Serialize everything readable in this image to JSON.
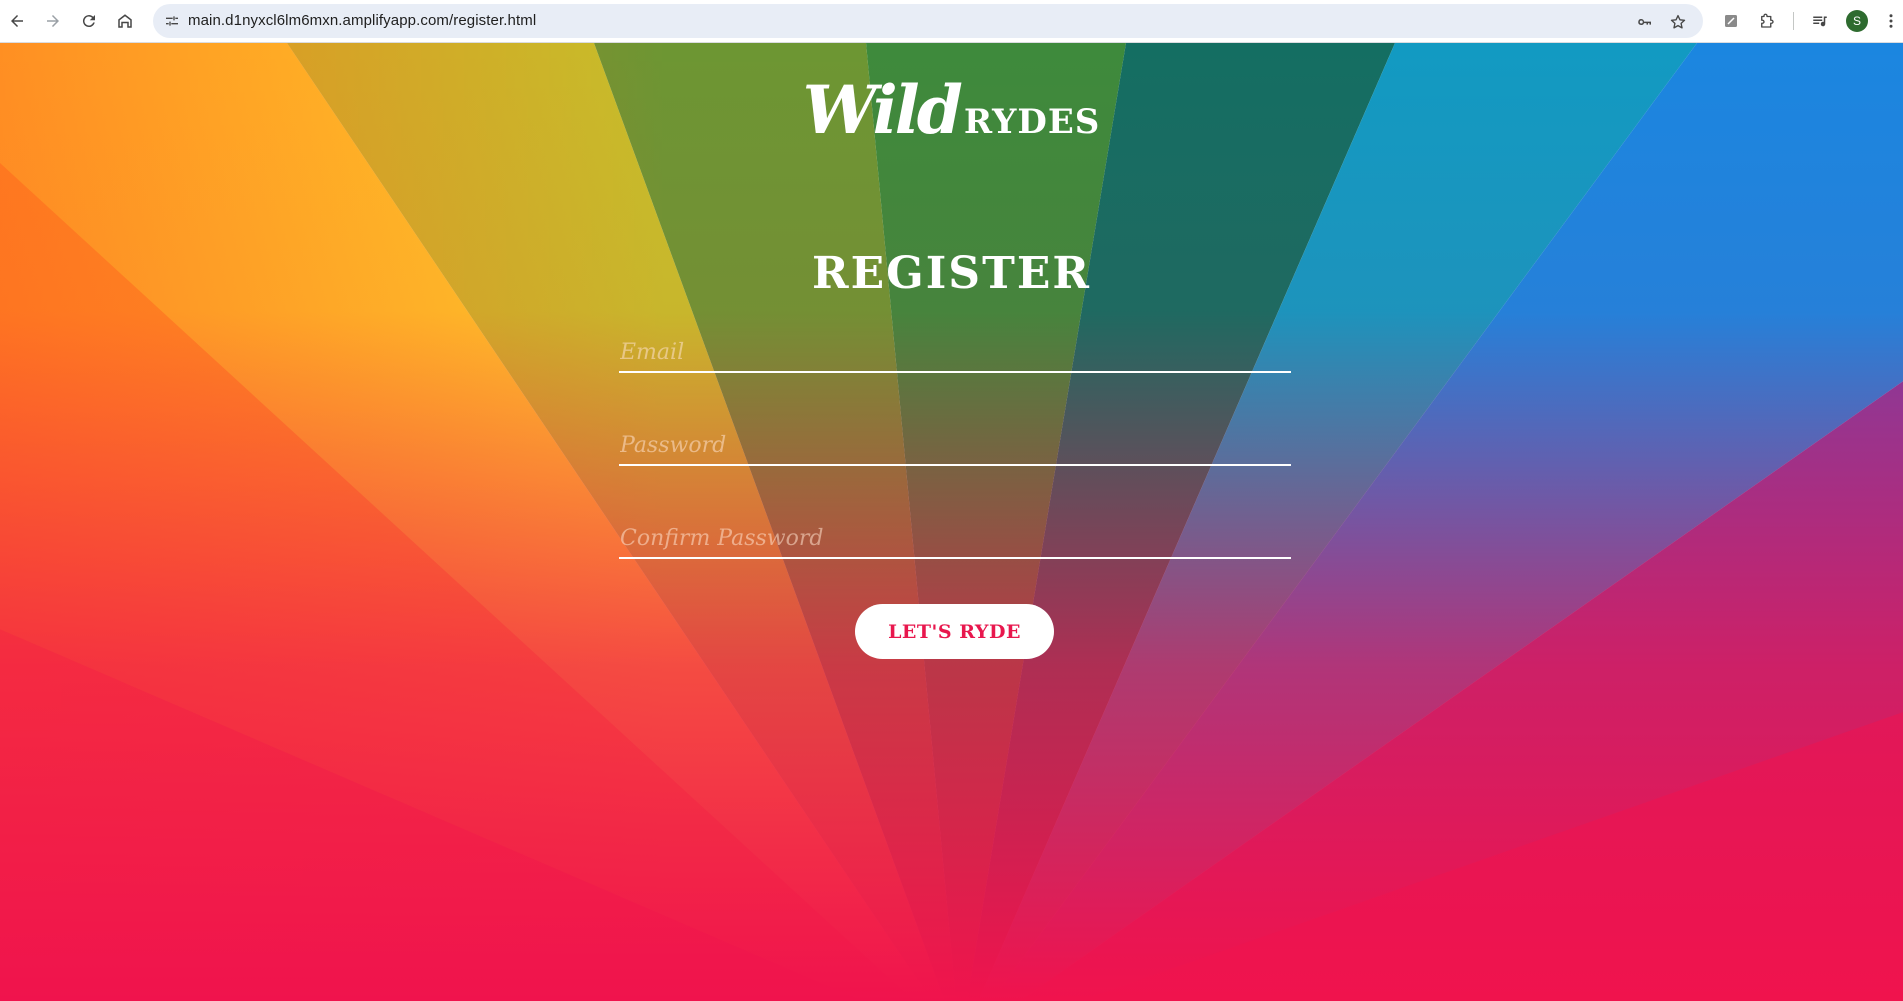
{
  "browser": {
    "url": "main.d1nyxcl6lm6mxn.amplifyapp.com/register.html",
    "profile_initial": "S",
    "icons": {
      "back": "arrow-left-icon",
      "forward": "arrow-right-icon",
      "reload": "reload-icon",
      "home": "home-icon",
      "site_info": "tune-icon",
      "password": "key-icon",
      "bookmark": "star-icon",
      "extension": "extension-puzzle-icon",
      "media": "media-queue-icon",
      "menu": "kebab-menu-icon"
    }
  },
  "logo": {
    "script_text": "Wild",
    "caps_text": "RYDES"
  },
  "form": {
    "title": "REGISTER",
    "email_placeholder": "Email",
    "password_placeholder": "Password",
    "confirm_placeholder": "Confirm Password",
    "submit_label": "LET'S RYDE"
  },
  "colors": {
    "button_text": "#e8174d",
    "background_rays": [
      "#ffd028",
      "#c6bf2a",
      "#6d9633",
      "#3e8a3c",
      "#146e62",
      "#129ac2",
      "#1b86e0",
      "#7b3fa3"
    ],
    "background_bottom": "#f0134d"
  }
}
